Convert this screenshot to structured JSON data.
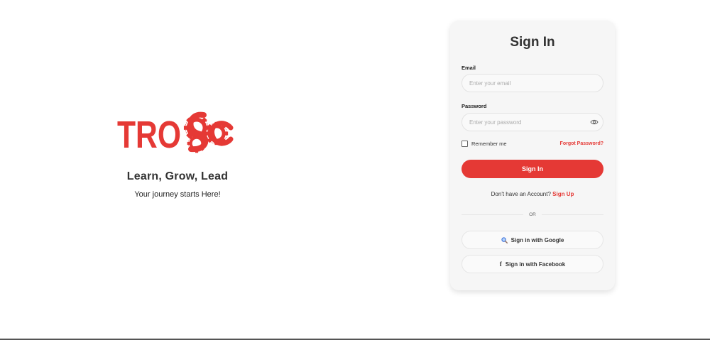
{
  "brand": {
    "logo_text": "TROSc",
    "tagline": "Learn, Grow, Lead",
    "subtagline": "Your journey starts Here!",
    "accent_color": "#e53935"
  },
  "signin": {
    "title": "Sign In",
    "email_label": "Email",
    "email_placeholder": "Enter your email",
    "email_value": "",
    "password_label": "Password",
    "password_placeholder": "Enter your password",
    "password_value": "",
    "password_toggle_icon": "eye-icon",
    "remember_label": "Remember me",
    "remember_checked": false,
    "forgot_label": "Forgot Password?",
    "submit_label": "Sign In",
    "no_account_text": "Don't have an Account?",
    "signup_label": "Sign Up",
    "divider_text": "OR",
    "google_label": "Sign in with Google",
    "google_icon": "search-icon",
    "facebook_label": "Sign in with Facebook",
    "facebook_icon": "facebook-icon"
  }
}
